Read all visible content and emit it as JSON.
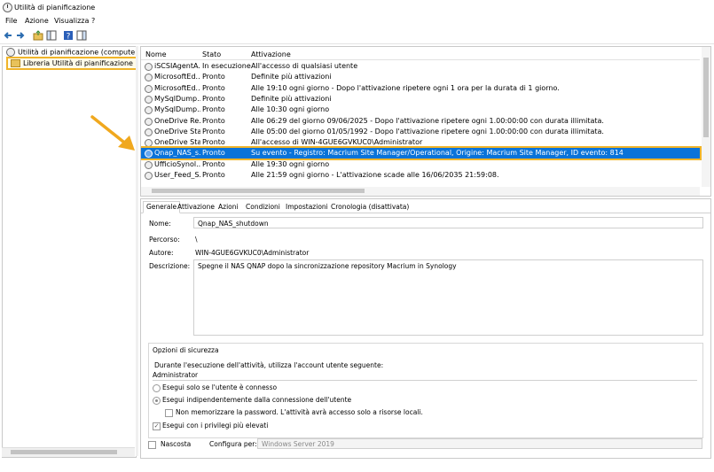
{
  "window": {
    "title": "Utilità di pianificazione"
  },
  "menu": {
    "items": [
      "File",
      "Azione",
      "Visualizza",
      "?"
    ]
  },
  "tree": {
    "root": "Utilità di pianificazione (computer locale)",
    "library": "Libreria Utilità di pianificazione"
  },
  "table": {
    "headers": [
      "Nome",
      "Stato",
      "Attivazione"
    ],
    "rows": [
      {
        "name": "iSCSIAgentA...",
        "status": "In esecuzione",
        "trigger": "All'accesso di qualsiasi utente"
      },
      {
        "name": "MicrosoftEd...",
        "status": "Pronto",
        "trigger": "Definite più attivazioni"
      },
      {
        "name": "MicrosoftEd...",
        "status": "Pronto",
        "trigger": "Alle 19:10 ogni giorno - Dopo l'attivazione ripetere ogni 1 ora per la durata di 1 giorno."
      },
      {
        "name": "MySqlDump...",
        "status": "Pronto",
        "trigger": "Definite più attivazioni"
      },
      {
        "name": "MySqlDump...",
        "status": "Pronto",
        "trigger": "Alle 10:30 ogni giorno"
      },
      {
        "name": "OneDrive Re...",
        "status": "Pronto",
        "trigger": "Alle 06:29 del giorno 09/06/2025 - Dopo l'attivazione ripetere ogni 1.00:00:00 con durata illimitata."
      },
      {
        "name": "OneDrive Sta...",
        "status": "Pronto",
        "trigger": "Alle 05:00 del giorno 01/05/1992 - Dopo l'attivazione ripetere ogni 1.00:00:00 con durata illimitata."
      },
      {
        "name": "OneDrive Sta...",
        "status": "Pronto",
        "trigger": "All'accesso di WIN-4GUE6GVKUC0\\Administrator"
      },
      {
        "name": "Qnap_NAS_s...",
        "status": "Pronto",
        "trigger": "Su evento - Registro: Macrium Site Manager/Operational, Origine: Macrium Site Manager, ID evento: 814"
      },
      {
        "name": "UfficioSynol...",
        "status": "Pronto",
        "trigger": "Alle 19:30 ogni giorno"
      },
      {
        "name": "User_Feed_S...",
        "status": "Pronto",
        "trigger": "Alle 21:59 ogni giorno - L'attivazione scade alle 16/06/2035 21:59:08."
      }
    ],
    "selected_index": 8
  },
  "tabs": [
    "Generale",
    "Attivazione",
    "Azioni",
    "Condizioni",
    "Impostazioni",
    "Cronologia (disattivata)"
  ],
  "general": {
    "name_label": "Nome:",
    "name_value": "Qnap_NAS_shutdown",
    "path_label": "Percorso:",
    "path_value": "\\",
    "author_label": "Autore:",
    "author_value": "WIN-4GUE6GVKUC0\\Administrator",
    "desc_label": "Descrizione:",
    "desc_value": "Spegne il NAS QNAP dopo la sincronizzazione repository Macrium in Synology"
  },
  "security": {
    "title": "Opzioni di sicurezza",
    "account_prompt": "Durante l'esecuzione dell'attività, utilizza l'account utente seguente:",
    "account": "Administrator",
    "opt_logged": "Esegui solo se l'utente è connesso",
    "opt_any": "Esegui indipendentemente dalla connessione dell'utente",
    "opt_nostore": "Non memorizzare la password. L'attività avrà accesso solo a risorse locali.",
    "opt_highest": "Esegui con i privilegi più elevati"
  },
  "footer": {
    "hidden_label": "Nascosta",
    "config_label": "Configura per:",
    "config_value": "Windows Server 2019"
  },
  "colors": {
    "selection": "#0a73d9",
    "highlight": "#f0b429"
  }
}
